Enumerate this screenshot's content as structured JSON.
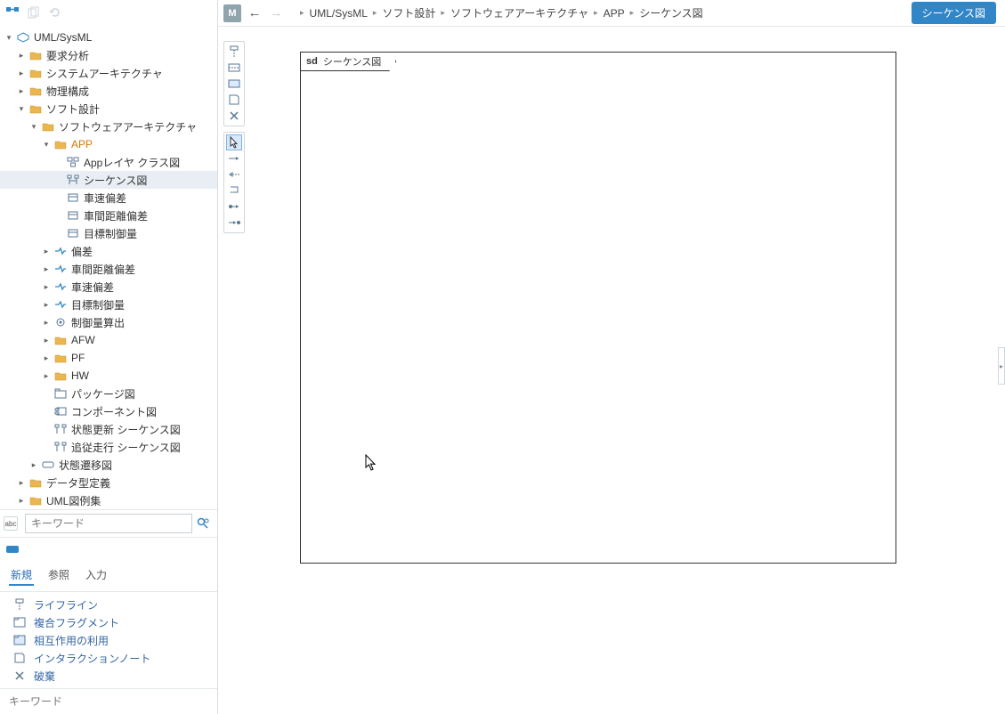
{
  "toolbar": {},
  "tree": {
    "root_label": "UML/SysML",
    "n_req": "要求分析",
    "n_sysarch": "システムアーキテクチャ",
    "n_phys": "物理構成",
    "n_soft": "ソフト設計",
    "n_swa": "ソフトウェアアーキテクチャ",
    "n_app": "APP",
    "n_app_class": "Appレイヤ クラス図",
    "n_seq": "シーケンス図",
    "n_vdev": "車速偏差",
    "n_gdev": "車間距離偏差",
    "n_target": "目標制御量",
    "n_dev": "偏差",
    "n_gdev2": "車間距離偏差",
    "n_vdev2": "車速偏差",
    "n_target2": "目標制御量",
    "n_calc": "制御量算出",
    "n_afw": "AFW",
    "n_pf": "PF",
    "n_hw": "HW",
    "n_pkg": "パッケージ図",
    "n_comp": "コンポーネント図",
    "n_seq_state": "状態更新 シーケンス図",
    "n_seq_follow": "追従走行 シーケンス図",
    "n_sm": "状態遷移図",
    "n_types": "データ型定義",
    "n_examples": "UML図例集"
  },
  "search": {
    "placeholder": "キーワード"
  },
  "tabs": {
    "t1": "新規",
    "t2": "参照",
    "t3": "入力"
  },
  "palette": {
    "items": [
      "ライフライン",
      "複合フラグメント",
      "相互作用の利用",
      "インタラクションノート",
      "破棄"
    ]
  },
  "bottom_search": {
    "placeholder": "キーワード"
  },
  "topbar": {
    "badge": "M",
    "breadcrumb": [
      "UML/SysML",
      "ソフト設計",
      "ソフトウェアアーキテクチャ",
      "APP",
      "シーケンス図"
    ],
    "pill": "シーケンス図"
  },
  "diagram": {
    "frame_prefix": "sd",
    "frame_title": "シーケンス図"
  }
}
